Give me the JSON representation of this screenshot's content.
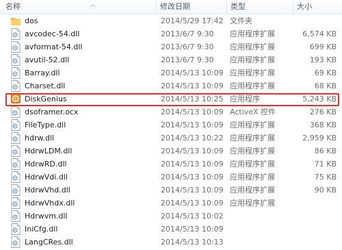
{
  "header": {
    "name": "名称",
    "date": "修改日期",
    "type": "类型",
    "size": "大小"
  },
  "files": [
    {
      "name": "dos",
      "date": "2014/5/29 17:42",
      "type": "文件夹",
      "size": "",
      "icon": "folder"
    },
    {
      "name": "avcodec-54.dll",
      "date": "2013/6/7 9:30",
      "type": "应用程序扩展",
      "size": "6,574 KB",
      "icon": "dll"
    },
    {
      "name": "avformat-54.dll",
      "date": "2013/6/7 9:30",
      "type": "应用程序扩展",
      "size": "699 KB",
      "icon": "dll"
    },
    {
      "name": "avutil-52.dll",
      "date": "2013/6/7 9:30",
      "type": "应用程序扩展",
      "size": "193 KB",
      "icon": "dll"
    },
    {
      "name": "Barray.dll",
      "date": "2014/5/13 10:09",
      "type": "应用程序扩展",
      "size": "69 KB",
      "icon": "dll"
    },
    {
      "name": "Charset.dll",
      "date": "2014/5/13 10:09",
      "type": "应用程序扩展",
      "size": "68 KB",
      "icon": "dll"
    },
    {
      "name": "DiskGenius",
      "date": "2014/5/13 10:25",
      "type": "应用程序",
      "size": "5,243 KB",
      "icon": "exe",
      "highlighted": true
    },
    {
      "name": "dsoframer.ocx",
      "date": "2014/5/13 10:09",
      "type": "ActiveX 控件",
      "size": "276 KB",
      "icon": "dll"
    },
    {
      "name": "FileType.dll",
      "date": "2014/5/13 10:09",
      "type": "应用程序扩展",
      "size": "368 KB",
      "icon": "dll"
    },
    {
      "name": "hdrw.dll",
      "date": "2014/5/13 10:22",
      "type": "应用程序扩展",
      "size": "2,959 KB",
      "icon": "dll"
    },
    {
      "name": "HdrwLDM.dll",
      "date": "2014/5/13 10:09",
      "type": "应用程序扩展",
      "size": "86 KB",
      "icon": "dll"
    },
    {
      "name": "HdrwRD.dll",
      "date": "2014/5/13 10:09",
      "type": "应用程序扩展",
      "size": "71 KB",
      "icon": "dll"
    },
    {
      "name": "HdrwVdi.dll",
      "date": "2014/5/13 10:09",
      "type": "应用程序扩展",
      "size": "75 KB",
      "icon": "dll"
    },
    {
      "name": "HdrwVhd.dll",
      "date": "2014/5/13 10:09",
      "type": "应用程序扩展",
      "size": "90 KB",
      "icon": "dll"
    },
    {
      "name": "HdrwVhdx.dll",
      "date": "2014/5/13 10:09",
      "type": "应用程序扩展",
      "size": "",
      "icon": "dll"
    },
    {
      "name": "Hdrwvm.dll",
      "date": "2014/5/13 10:02",
      "type": "",
      "size": "",
      "icon": "dll"
    },
    {
      "name": "IniCfg.dll",
      "date": "2014/5/13 10:09",
      "type": "",
      "size": "",
      "icon": "dll"
    },
    {
      "name": "LangCRes.dll",
      "date": "2014/5/13 10:13",
      "type": "",
      "size": "",
      "icon": "dll"
    }
  ],
  "colors": {
    "highlight": "#e2302a",
    "header_text": "#4c607a"
  }
}
